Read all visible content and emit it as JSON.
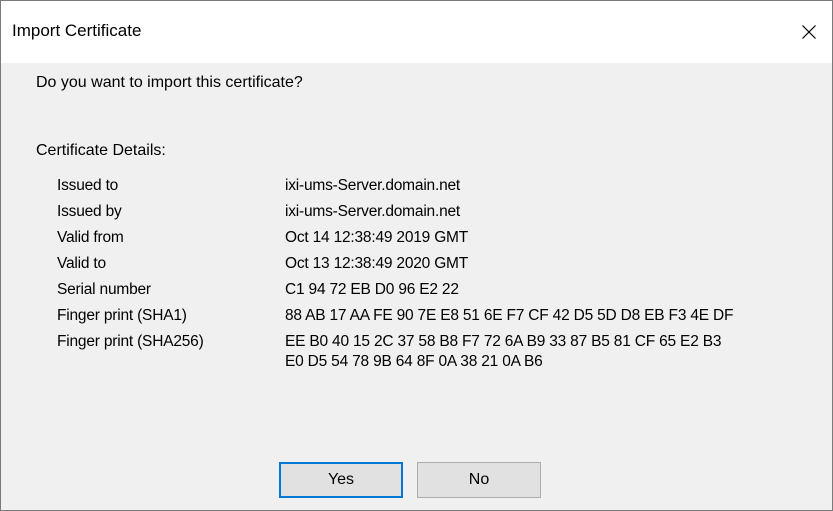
{
  "window": {
    "title": "Import Certificate",
    "close_icon": "close-icon"
  },
  "dialog": {
    "question": "Do you want to import this certificate?",
    "section_label": "Certificate Details:",
    "details": [
      {
        "label": "Issued to",
        "value": "ixi-ums-Server.domain.net"
      },
      {
        "label": "Issued by",
        "value": "ixi-ums-Server.domain.net"
      },
      {
        "label": "Valid from",
        "value": "Oct 14 12:38:49 2019 GMT"
      },
      {
        "label": "Valid to",
        "value": "Oct 13 12:38:49 2020 GMT"
      },
      {
        "label": "Serial number",
        "value": "C1 94 72 EB D0 96 E2 22"
      },
      {
        "label": "Finger print (SHA1)",
        "value": "88 AB 17 AA FE 90 7E E8 51 6E F7 CF 42 D5 5D D8 EB F3 4E DF"
      },
      {
        "label": "Finger print (SHA256)",
        "value": "EE B0 40 15 2C 37 58 B8 F7 72 6A B9 33 87 B5 81 CF 65 E2 B3\nE0 D5 54 78 9B 64 8F 0A 38 21 0A B6"
      }
    ],
    "buttons": {
      "yes_label": "Yes",
      "no_label": "No"
    }
  },
  "colors": {
    "dialog_background": "#f0f0f0",
    "titlebar_background": "#ffffff",
    "button_background": "#e1e1e1",
    "focus_border": "#0078d7"
  }
}
